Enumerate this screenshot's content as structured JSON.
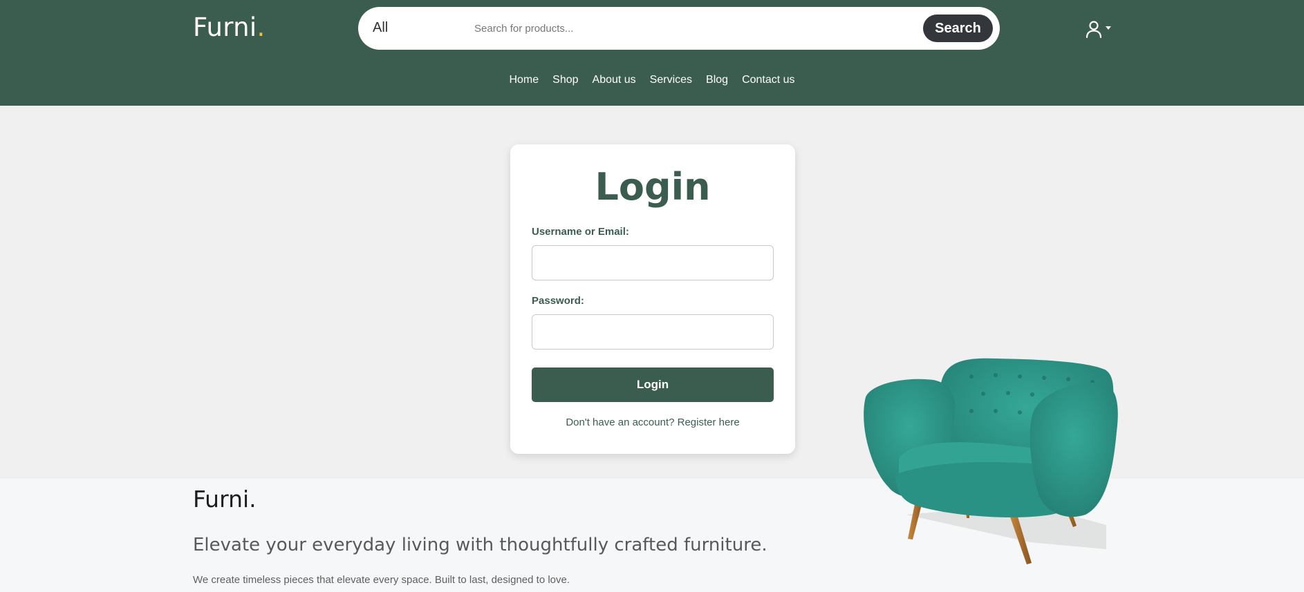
{
  "header": {
    "logo_text": "Furni",
    "logo_dot": ".",
    "search": {
      "category": "All",
      "placeholder": "Search for products...",
      "button_label": "Search"
    },
    "user_icon": "user-icon",
    "nav": [
      {
        "label": "Home"
      },
      {
        "label": "Shop"
      },
      {
        "label": "About us"
      },
      {
        "label": "Services"
      },
      {
        "label": "Blog"
      },
      {
        "label": "Contact us"
      }
    ]
  },
  "login": {
    "title": "Login",
    "username_label": "Username or Email:",
    "password_label": "Password:",
    "submit_label": "Login",
    "register_text": "Don't have an account? Register here"
  },
  "footer": {
    "logo": "Furni.",
    "tagline": "Elevate your everyday living with thoughtfully crafted furniture.",
    "subtext": "We create timeless pieces that elevate every space. Built to last, designed to love."
  },
  "colors": {
    "brand_green": "#3b5d50",
    "accent_yellow": "#f9bf29",
    "search_button": "#33373b",
    "chair_teal": "#2e9a8c"
  }
}
